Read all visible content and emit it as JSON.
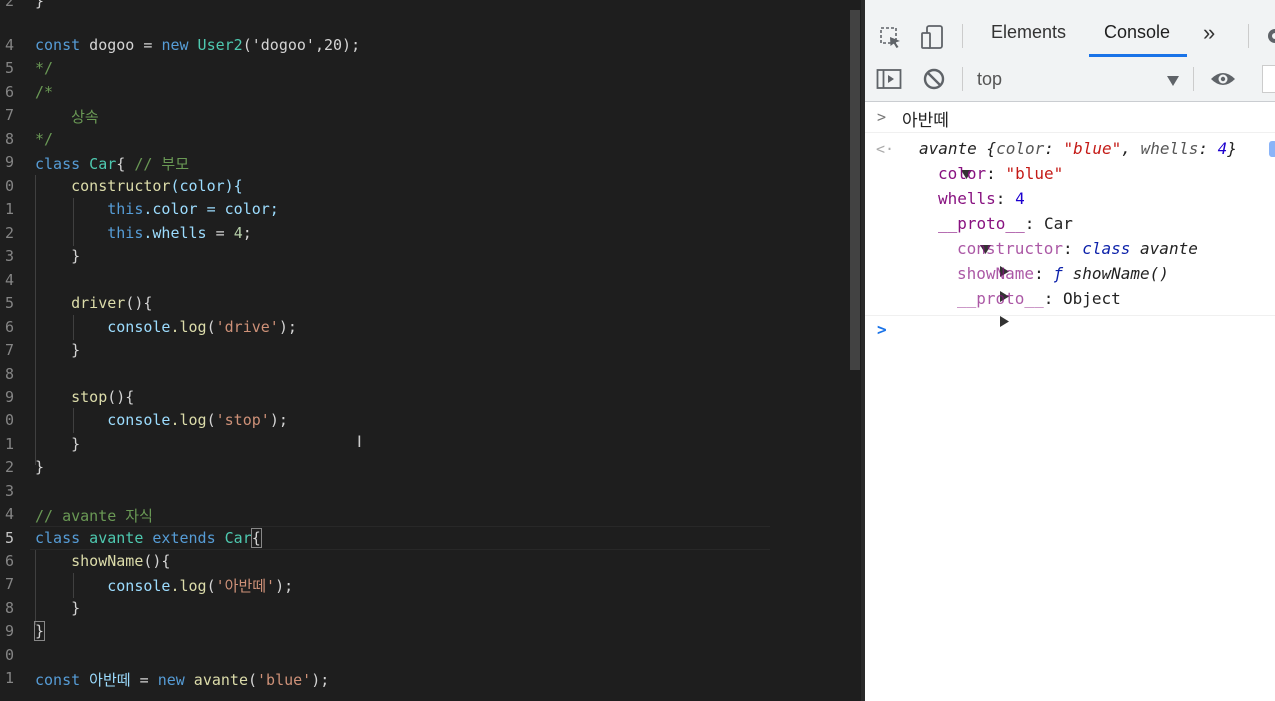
{
  "editor": {
    "line_numbers": [
      "2",
      "4",
      "5",
      "6",
      "7",
      "8",
      "9",
      "0",
      "1",
      "2",
      "3",
      "4",
      "5",
      "6",
      "7",
      "8",
      "9",
      "0",
      "1",
      "2",
      "3",
      "4",
      "5",
      "6",
      "7",
      "8",
      "9",
      "0",
      "1"
    ],
    "lines": {
      "l0": "}",
      "l1": {
        "kw": "const",
        "name": " dogoo = ",
        "kw2": "new",
        "cls": " User2",
        "args": "('dogoo',20);"
      },
      "l2": "*/",
      "l3": "/*",
      "l4": "    상속",
      "l5": "*/",
      "l6": {
        "kw": "class",
        "cls": " Car",
        "brace": "{ ",
        "cm": "// 부모"
      },
      "l7": {
        "fn": "constructor",
        "args": "(color){"
      },
      "l8": {
        "kw": "this",
        "prop": ".color",
        "rest": " = color;"
      },
      "l9": {
        "kw": "this",
        "prop": ".whells",
        "rest": " = ",
        "num": "4",
        ";": ";"
      },
      "l10": "}",
      "l12": {
        "fn": "driver",
        "rest": "(){"
      },
      "l13": {
        "obj": "console",
        "fn": ".log",
        "open": "(",
        "str": "'drive'",
        "close": ");"
      },
      "l14": "}",
      "l16": {
        "fn": "stop",
        "rest": "(){"
      },
      "l17": {
        "obj": "console",
        "fn": ".log",
        "open": "(",
        "str": "'stop'",
        "close": ");"
      },
      "l18": "}",
      "l19": "}",
      "l21": "// avante 자식",
      "l22": {
        "kw": "class",
        "cls": " avante",
        "kw2": " extends",
        "cls2": " Car",
        "brace": "{"
      },
      "l23": {
        "fn": "showName",
        "rest": "(){"
      },
      "l24": {
        "obj": "console",
        "fn": ".log",
        "open": "(",
        "str": "'아반떼'",
        "close": ");"
      },
      "l25": "}",
      "l26": "}",
      "l28": {
        "kw": "const",
        "var": " 아반떼",
        "eq": " = ",
        "kw2": "new",
        "cls": " avante",
        "open": "(",
        "str": "'blue'",
        "close": ");"
      }
    }
  },
  "devtools": {
    "tabs": {
      "elements": "Elements",
      "console": "Console",
      "more": "»"
    },
    "context": "top",
    "console": {
      "input_echo": "아반떼",
      "obj_name": "avante",
      "obj_open": " {",
      "obj_k1": "color",
      "obj_colon": ": ",
      "obj_v1": "\"blue\"",
      "obj_comma": ", ",
      "obj_k2": "whells",
      "obj_v2": "4",
      "obj_close": "}",
      "p_color_k": "color",
      "p_color_v": "\"blue\"",
      "p_whells_k": "whells",
      "p_whells_v": "4",
      "proto_k": "__proto__",
      "proto_v": "Car",
      "c_k": "constructor",
      "c_v_kw": "class",
      "c_v_name": " avante",
      "s_k": "showName",
      "s_v_f": "ƒ",
      "s_v_name": " showName()",
      "pp_k": "__proto__",
      "pp_v": "Object",
      "prompt": ">"
    }
  },
  "colors": {
    "accent": "#1a73e8",
    "editor_bg": "#1e1e1e"
  }
}
